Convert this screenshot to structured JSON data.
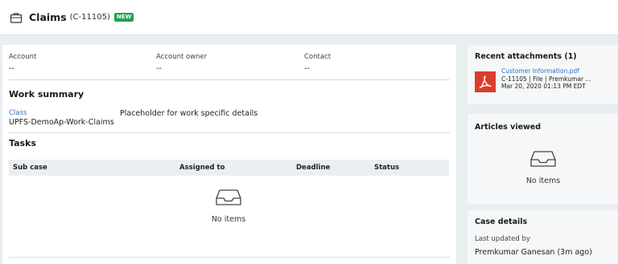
{
  "header": {
    "title": "Claims",
    "case_id": "(C-11105)",
    "badge": "NEW",
    "icon": "briefcase-icon"
  },
  "main": {
    "fields": [
      {
        "label": "Account",
        "value": "--"
      },
      {
        "label": "Account owner",
        "value": "--"
      },
      {
        "label": "Contact",
        "value": "--"
      }
    ],
    "work_summary": {
      "title": "Work summary",
      "class_label": "Class",
      "class_value": "UPFS-DemoAp-Work-Claims",
      "placeholder": "Placeholder for work specific details"
    },
    "tasks": {
      "title": "Tasks",
      "columns": [
        "Sub case",
        "Assigned to",
        "Deadline",
        "Status"
      ],
      "empty_text": "No items"
    }
  },
  "sidebar": {
    "attachments": {
      "title": "Recent attachments (1)",
      "file_name": "Customer Information.pdf",
      "file_meta": "C-11105 | File | Premkumar ...",
      "file_date": "Mar 20, 2020 01:13 PM EDT",
      "icon": "pdf-icon"
    },
    "articles": {
      "title": "Articles viewed",
      "empty_text": "No items"
    },
    "case_details": {
      "title": "Case details",
      "updated_label": "Last updated by",
      "updated_value": "Premkumar Ganesan (3m ago)"
    }
  },
  "colors": {
    "accent_link": "#2f6fcf",
    "badge_green": "#22a34a",
    "pdf_red": "#dc3b2f",
    "background": "#e9eef1"
  }
}
